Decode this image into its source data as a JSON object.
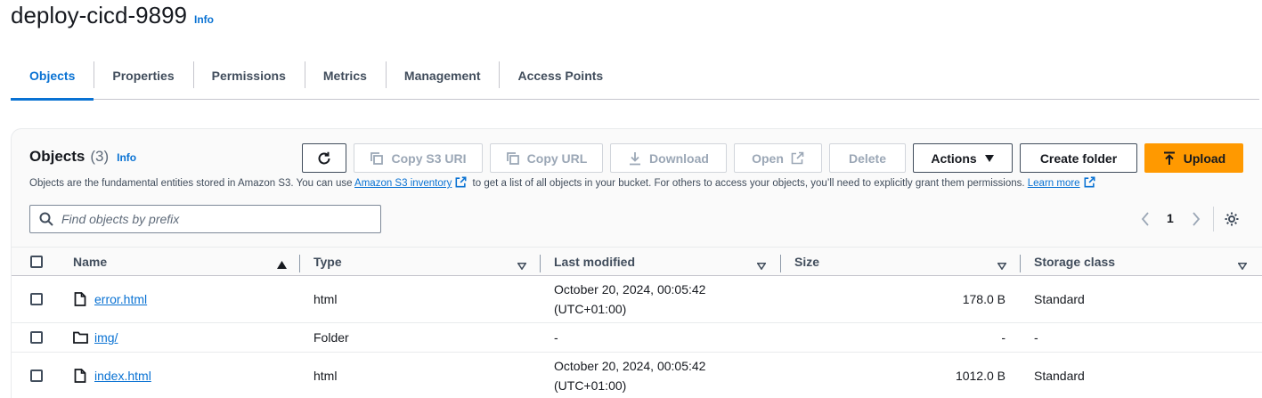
{
  "header": {
    "bucket_name": "deploy-cicd-9899",
    "info": "Info"
  },
  "tabs": [
    {
      "label": "Objects",
      "active": true
    },
    {
      "label": "Properties",
      "active": false
    },
    {
      "label": "Permissions",
      "active": false
    },
    {
      "label": "Metrics",
      "active": false
    },
    {
      "label": "Management",
      "active": false
    },
    {
      "label": "Access Points",
      "active": false
    }
  ],
  "objects_panel": {
    "title": "Objects",
    "count": "(3)",
    "info": "Info",
    "buttons": {
      "refresh": "refresh-icon",
      "copy_s3_uri": "Copy S3 URI",
      "copy_url": "Copy URL",
      "download": "Download",
      "open": "Open",
      "delete": "Delete",
      "actions": "Actions",
      "create_folder": "Create folder",
      "upload": "Upload"
    },
    "description": {
      "part1": "Objects are the fundamental entities stored in Amazon S3. You can use ",
      "link1": "Amazon S3 inventory",
      "part2": " to get a list of all objects in your bucket. For others to access your objects, you’ll need to explicitly grant them permissions. ",
      "link2": "Learn more"
    },
    "search": {
      "placeholder": "Find objects by prefix",
      "value": ""
    },
    "pagination": {
      "page": "1"
    }
  },
  "table": {
    "columns": [
      "Name",
      "Type",
      "Last modified",
      "Size",
      "Storage class"
    ],
    "rows": [
      {
        "name": "error.html",
        "kind": "file",
        "type": "html",
        "modified_line1": "October 20, 2024, 00:05:42",
        "modified_line2": "(UTC+01:00)",
        "size": "178.0 B",
        "storage": "Standard"
      },
      {
        "name": "img/",
        "kind": "folder",
        "type": "Folder",
        "modified_line1": "-",
        "modified_line2": "",
        "size": "-",
        "storage": "-"
      },
      {
        "name": "index.html",
        "kind": "file",
        "type": "html",
        "modified_line1": "October 20, 2024, 00:05:42",
        "modified_line2": "(UTC+01:00)",
        "size": "1012.0 B",
        "storage": "Standard"
      }
    ]
  },
  "colors": {
    "accent": "#0972d3",
    "primary_button": "#ff9900",
    "text": "#16191f",
    "muted": "#5f6b7a"
  }
}
